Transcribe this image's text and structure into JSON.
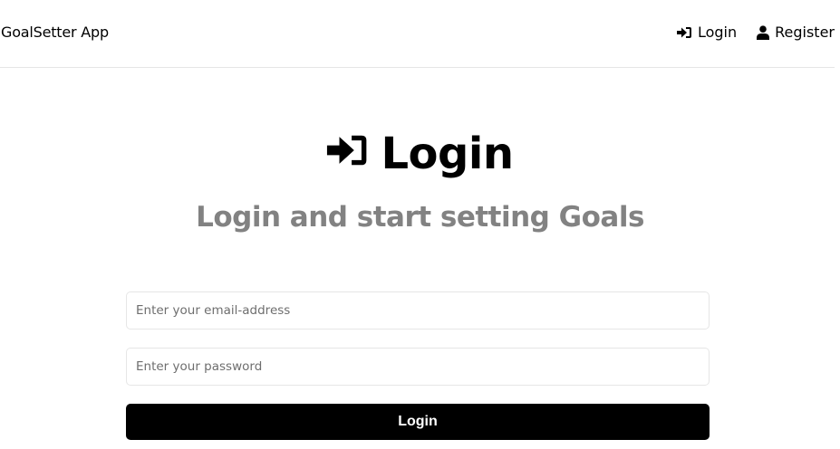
{
  "header": {
    "brand": "GoalSetter App",
    "nav": [
      {
        "label": "Login",
        "icon": "sign-in-icon"
      },
      {
        "label": "Register",
        "icon": "user-icon"
      }
    ]
  },
  "main": {
    "title": "Login",
    "title_icon": "sign-in-icon",
    "subtitle": "Login and start setting Goals",
    "form": {
      "email": {
        "value": "",
        "placeholder": "Enter your email-address"
      },
      "password": {
        "value": "",
        "placeholder": "Enter your password"
      },
      "submit_label": "Login"
    }
  },
  "colors": {
    "button_bg": "#000000",
    "subtitle": "#828282",
    "border": "#e6e6e6"
  }
}
